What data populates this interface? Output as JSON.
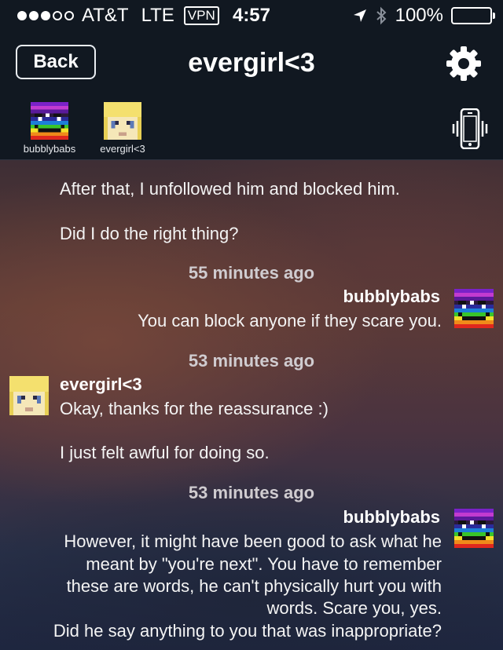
{
  "status_bar": {
    "carrier": "AT&T",
    "network": "LTE",
    "vpn": "VPN",
    "time": "4:57",
    "battery": "100%",
    "signal_bars_filled": 3,
    "signal_bars_total": 5
  },
  "nav": {
    "back_label": "Back",
    "title": "evergirl<3",
    "settings_icon": "gear-icon"
  },
  "participants": [
    {
      "name": "bubblybabs",
      "avatar": "rainbow-pixel-avatar"
    },
    {
      "name": "evergirl<3",
      "avatar": "blonde-pixel-avatar"
    }
  ],
  "vibrate_icon": "phone-vibrate-icon",
  "messages": {
    "m1_text": "After that, I unfollowed him and blocked him.",
    "m2_text": "Did I do the right thing?",
    "ts1": "55 minutes ago",
    "m3_sender": "bubblybabs",
    "m3_text": "You can block anyone if they scare you.",
    "ts2": "53 minutes ago",
    "m4_sender": "evergirl<3",
    "m4_text": "Okay, thanks for the reassurance :)",
    "m5_text": "I just felt awful for doing so.",
    "ts3": "53 minutes ago",
    "m6_sender": "bubblybabs",
    "m6_lines": [
      "However, it might have been good to ask what he",
      "meant by \"you're next\".  You have to remember",
      "these are words, he can't physically hurt you with",
      "words.  Scare you, yes.",
      "Did he say anything to you that was inappropriate?"
    ]
  },
  "colors": {
    "header_bg": "#111821",
    "timestamp": "#d0ccd0",
    "text": "#f4f4f4"
  }
}
